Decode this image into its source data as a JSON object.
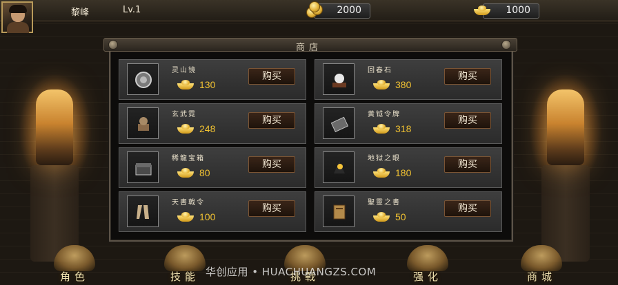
{
  "player": {
    "name": "黎峰",
    "level": "Lv.1"
  },
  "resources": {
    "coins": {
      "value": "2000",
      "icon": "coin-stack-icon"
    },
    "gold": {
      "value": "1000",
      "icon": "gold-ingot-icon"
    }
  },
  "shop": {
    "title": "商店",
    "buy_label": "购买",
    "items": [
      {
        "name": "灵山镜",
        "price": "130",
        "icon": "bronze-mirror-icon"
      },
      {
        "name": "回春石",
        "price": "380",
        "icon": "pearl-stone-icon"
      },
      {
        "name": "玄武霓",
        "price": "248",
        "icon": "tortoise-statue-icon"
      },
      {
        "name": "黄钺令牌",
        "price": "318",
        "icon": "token-plaque-icon"
      },
      {
        "name": "稀龍宝箱",
        "price": "80",
        "icon": "treasure-chest-icon"
      },
      {
        "name": "地狱之眼",
        "price": "180",
        "icon": "demon-eye-icon"
      },
      {
        "name": "天書戟令",
        "price": "100",
        "icon": "scroll-decree-icon"
      },
      {
        "name": "聖靈之書",
        "price": "50",
        "icon": "spell-book-icon"
      }
    ]
  },
  "nav": [
    {
      "label": "角色",
      "icon": "character-emblem-icon"
    },
    {
      "label": "技能",
      "icon": "skill-emblem-icon"
    },
    {
      "label": "挑戰",
      "icon": "challenge-emblem-icon"
    },
    {
      "label": "强化",
      "icon": "enhance-emblem-icon"
    },
    {
      "label": "商城",
      "icon": "mall-emblem-icon"
    }
  ],
  "watermark": "华创应用 • HUACHUANGZS.COM",
  "colors": {
    "price": "#f1c232",
    "frame": "#5c5348",
    "card": "#3a3a3a"
  }
}
